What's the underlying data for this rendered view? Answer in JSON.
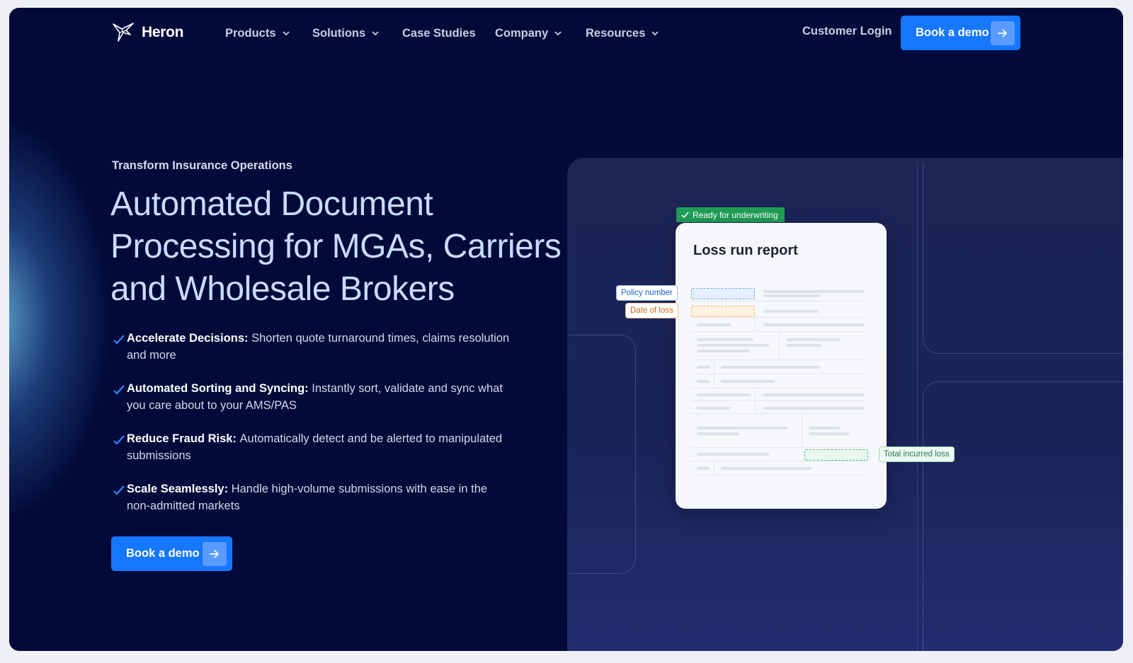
{
  "nav": {
    "brand": "Heron",
    "menu": [
      {
        "label": "Products",
        "has_dropdown": true
      },
      {
        "label": "Solutions",
        "has_dropdown": true
      },
      {
        "label": "Case Studies",
        "has_dropdown": false
      },
      {
        "label": "Company",
        "has_dropdown": true
      },
      {
        "label": "Resources",
        "has_dropdown": true
      }
    ],
    "login_label": "Customer Login",
    "cta_label": "Book a demo"
  },
  "hero": {
    "eyebrow": "Transform Insurance Operations",
    "headline_line1": "Automated Document",
    "headline_line2": "Processing for MGAs, Carriers",
    "headline_line3": "and Wholesale Brokers",
    "features": [
      {
        "title": "Accelerate Decisions:",
        "text": "Shorten quote turnaround times, claims resolution and more"
      },
      {
        "title": "Automated Sorting and Syncing:",
        "text": "Instantly sort, validate and sync what you care about to your AMS/PAS"
      },
      {
        "title": "Reduce Fraud Risk:",
        "text": "Automatically detect and be alerted to manipulated submissions"
      },
      {
        "title": "Scale Seamlessly:",
        "text": "Handle high-volume submissions with ease in the non-admitted markets"
      }
    ],
    "cta_label": "Book a demo"
  },
  "visual": {
    "status_badge": "Ready for underwriting",
    "card_title": "Loss run report",
    "tags": {
      "policy": "Policy number",
      "date": "Date of loss",
      "total": "Total incurred loss"
    }
  },
  "colors": {
    "background": "#020a3a",
    "accent": "#1677ff",
    "headline": "#c9dcff",
    "success": "#1f9d55"
  }
}
